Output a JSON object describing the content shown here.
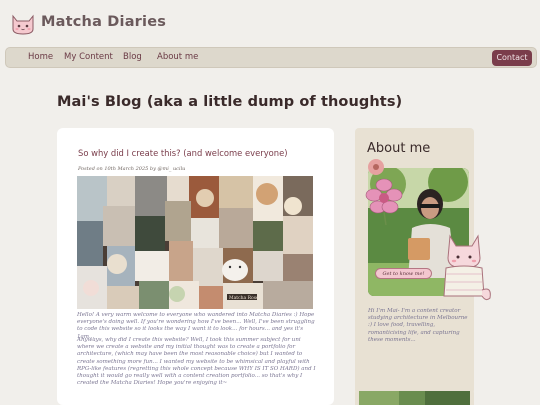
{
  "site": {
    "title": "Matcha Diaries",
    "logo_icon": "cat-face-icon"
  },
  "nav": {
    "items": [
      {
        "label": "Home"
      },
      {
        "label": "My Content"
      },
      {
        "label": "Blog"
      },
      {
        "label": "About me"
      }
    ],
    "contact_label": "Contact"
  },
  "blog": {
    "heading": "Mai's Blog (aka a little dump of thoughts)"
  },
  "post": {
    "title": "So why did I create this? (and welcome everyone)",
    "meta": "Posted on 10th March 2025 by @mi_ ucilu",
    "paragraph1": "Hello! A very warm welcome to everyone who wandered into Matcha Diaries :) Hope everyone's doing well. If you're wondering how I've been... Well, I've been struggling to code this website so it looks the way I want it to look... for hours... and yes it's 1am...",
    "paragraph2": "Anyways, why did I create this website? Well, I took this summer subject for uni where we create a website and my initial thought was to create a portfolio for architecture, (which may have been the most reasonable choice) but I wanted to create something more fun... I wanted my website to be whimsical and playful with RPG-like features (regretting this whole concept because WHY IS IT SO HARD) and I thought it would go really well with a content creation portfolio... so that's why I created the Matcha Diaries! Hope you're enjoying it~"
  },
  "about": {
    "title": "About me",
    "button_label": "Get to know me!",
    "text": "Hi I'm Mai- I'm a content creator studying architecture in Melbourne :) I love food, travelling, romanticising life, and capturing these moments..."
  },
  "colors": {
    "background": "#f1efeb",
    "navbar": "#ddd8cc",
    "accent": "#7a3d4b",
    "card": "#ffffff",
    "sidebar": "#e8e1d3",
    "body_text": "#7a7592"
  }
}
